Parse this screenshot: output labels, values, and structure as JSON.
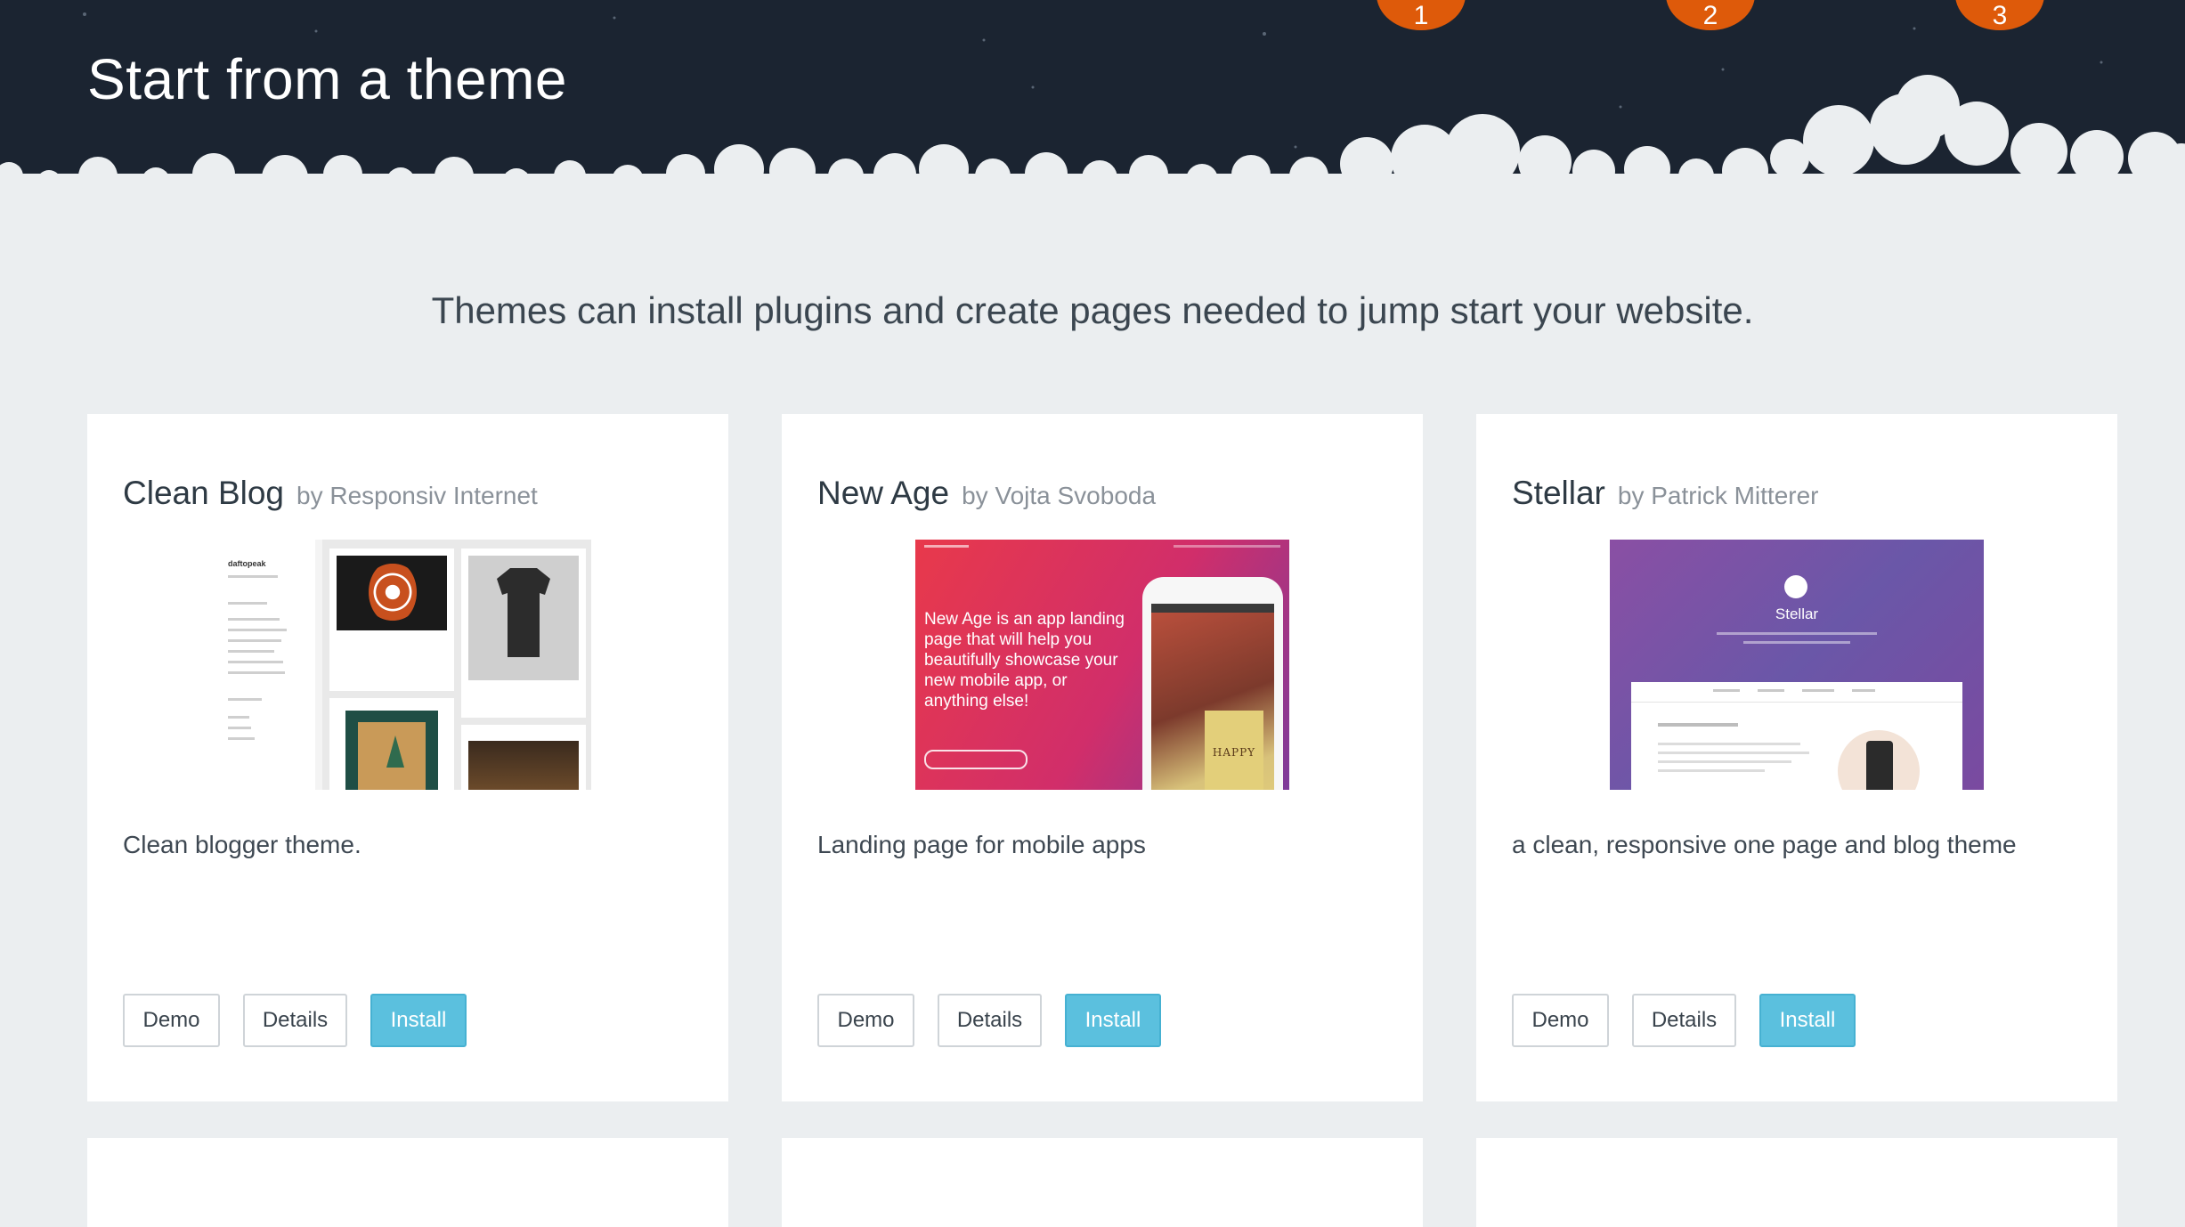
{
  "header": {
    "title": "Start from a theme",
    "steps": [
      "1",
      "2",
      "3"
    ]
  },
  "intro": "Themes can install plugins and create pages needed to jump start your website.",
  "themes": [
    {
      "name": "Clean Blog",
      "author": "by Responsiv Internet",
      "description": "Clean blogger theme.",
      "buttons": {
        "demo": "Demo",
        "details": "Details",
        "install": "Install"
      },
      "preview": {
        "logo": "daftopeak"
      }
    },
    {
      "name": "New Age",
      "author": "by Vojta Svoboda",
      "description": "Landing page for mobile apps",
      "buttons": {
        "demo": "Demo",
        "details": "Details",
        "install": "Install"
      },
      "preview": {
        "tagline": "New Age is an app landing page that will help you beautifully showcase your new mobile app, or anything else!",
        "phone_label": "HAPPY"
      }
    },
    {
      "name": "Stellar",
      "author": "by Patrick Mitterer",
      "description": "a clean, responsive one page and blog theme",
      "buttons": {
        "demo": "Demo",
        "details": "Details",
        "install": "Install"
      },
      "preview": {
        "site_name": "Stellar"
      }
    }
  ],
  "colors": {
    "header_bg": "#1b2431",
    "step_badge": "#de5a0a",
    "install_button": "#5bc0de",
    "page_bg": "#ebeef0"
  }
}
